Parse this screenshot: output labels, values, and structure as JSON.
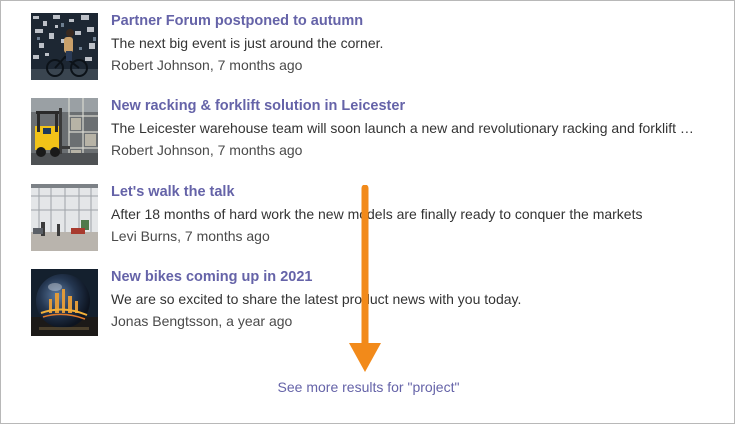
{
  "results": [
    {
      "title": "Partner Forum postponed to autumn",
      "excerpt": "The next big event is just around the corner.",
      "meta": "Robert Johnson, 7 months ago",
      "thumb": "cyclist-photo"
    },
    {
      "title": "New racking & forklift solution in Leicester",
      "excerpt": "The Leicester warehouse team will soon launch a new and revolutionary racking and forklift …",
      "meta": "Robert Johnson, 7 months ago",
      "thumb": "forklift-photo"
    },
    {
      "title": "Let's walk the talk",
      "excerpt": "After 18 months of hard work the new models are finally ready to conquer the markets",
      "meta": "Levi Burns, 7 months ago",
      "thumb": "office-lobby-photo"
    },
    {
      "title": "New bikes coming up in 2021",
      "excerpt": "We are so excited to share the latest product news with you today.",
      "meta": "Jonas Bengtsson, a year ago",
      "thumb": "crystal-ball-city-photo"
    }
  ],
  "see_more": "See more results for \"project\"",
  "colors": {
    "link": "#6563a8",
    "arrow": "#f28a1a",
    "border": "#b8b8b8"
  }
}
